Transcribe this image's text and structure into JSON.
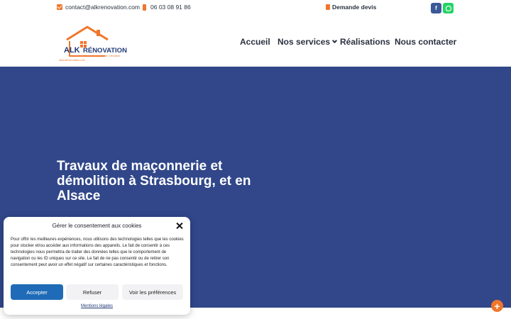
{
  "topbar": {
    "email": "contact@alkrenovation.com",
    "phone": "06 03 08 91 86",
    "quote_label": "Demande devis",
    "social": {
      "facebook_icon": "facebook-icon",
      "whatsapp_icon": "whatsapp-icon"
    }
  },
  "logo": {
    "brand": "ALK",
    "name": "RÉNOVATION",
    "tagline": "Travaux de maçonnerie - Démolition",
    "url": "www.alkrenovation.com"
  },
  "nav": {
    "items": [
      "Accueil",
      "Nos services",
      "Réalisations",
      "Nous contacter"
    ]
  },
  "hero": {
    "title": "Travaux de maçonnerie et démolition à Strasbourg, et en Alsace"
  },
  "cookie": {
    "title": "Gérer le consentement aux cookies",
    "text": "Pour offrir les meilleures expériences, nous utilisons des technologies telles que les cookies pour stocker et/ou accéder aux informations des appareils. Le fait de consentir à ces technologies nous permettra de traiter des données telles que le comportement de navigation ou les ID uniques sur ce site. Le fait de ne pas consentir ou de retirer son consentement peut avoir un effet négatif sur certaines caractéristiques et fonctions.",
    "accept": "Accepter",
    "refuse": "Refuser",
    "prefs": "Voir les préférences",
    "legal_link": "Mentions légales"
  },
  "colors": {
    "brand_blue": "#31478a",
    "accent_orange": "#f0762b",
    "accept_blue": "#1f6bb7"
  }
}
